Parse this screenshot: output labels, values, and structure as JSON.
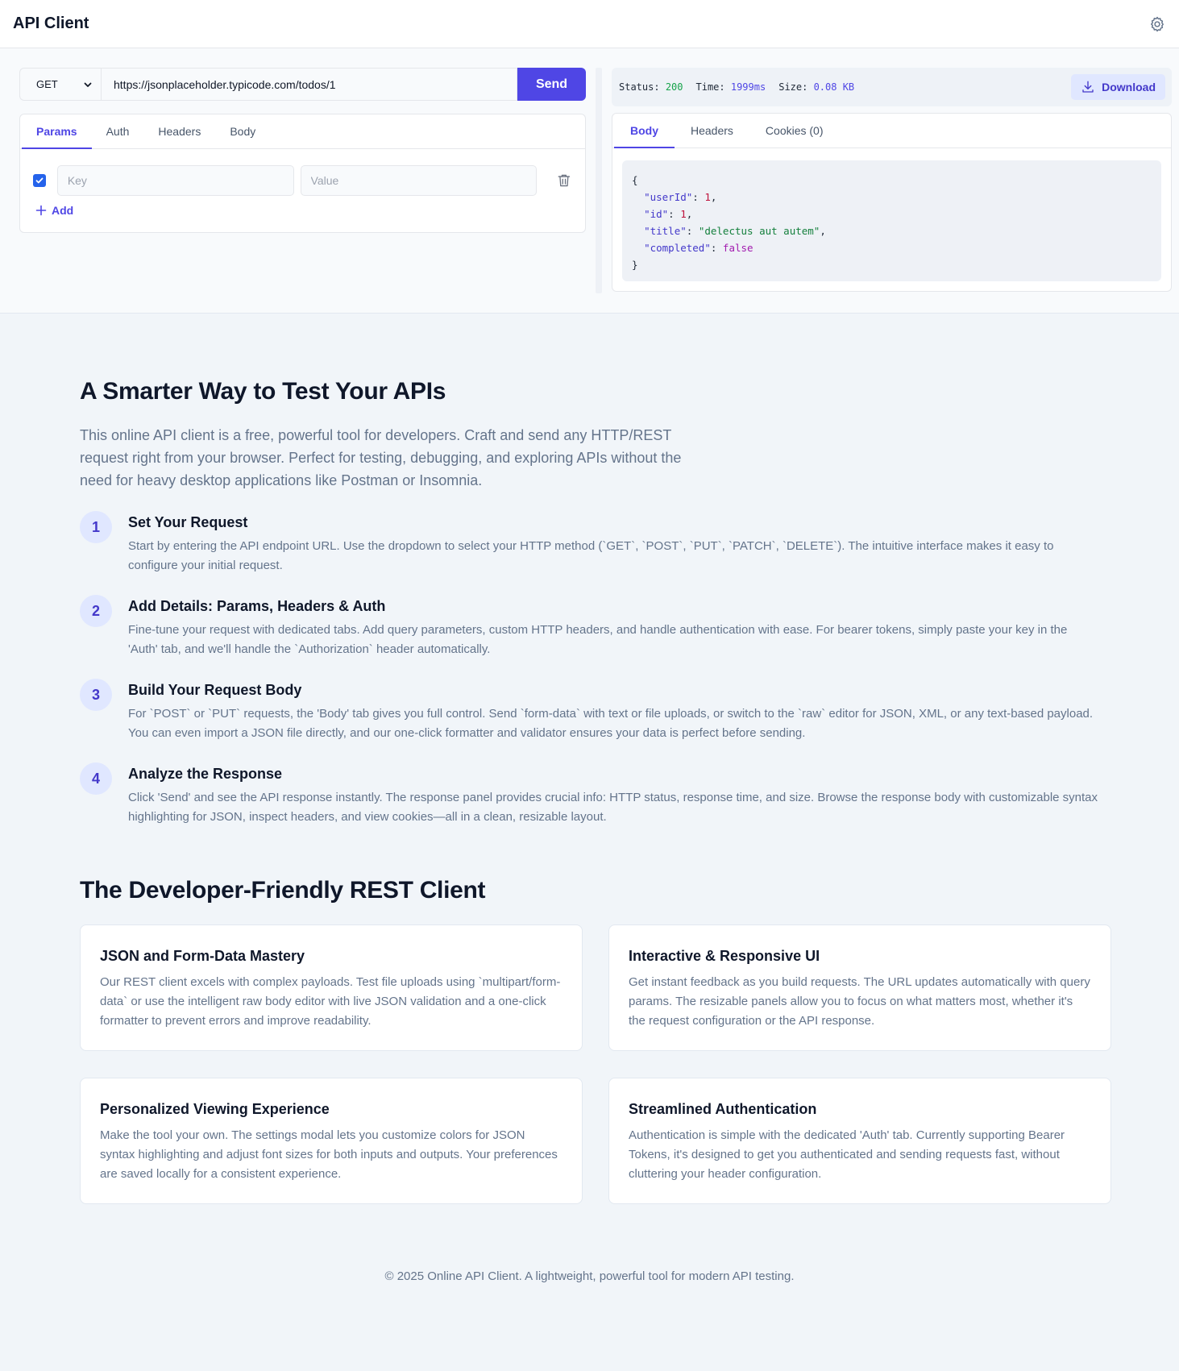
{
  "header": {
    "title": "API Client",
    "settings_icon": "gear-icon"
  },
  "request": {
    "method": "GET",
    "method_options": [
      "GET",
      "POST",
      "PUT",
      "PATCH",
      "DELETE"
    ],
    "url": "https://jsonplaceholder.typicode.com/todos/1",
    "send_label": "Send",
    "tabs": [
      "Params",
      "Auth",
      "Headers",
      "Body"
    ],
    "active_tab": "Params",
    "param": {
      "enabled": true,
      "key_placeholder": "Key",
      "value_placeholder": "Value"
    },
    "add_label": "Add"
  },
  "response": {
    "status_label": "Status:",
    "status_value": "200",
    "time_label": "Time:",
    "time_value": "1999ms",
    "size_label": "Size:",
    "size_value": "0.08 KB",
    "download_label": "Download",
    "tabs": [
      "Body",
      "Headers",
      "Cookies (0)"
    ],
    "active_tab": "Body",
    "body": [
      {
        "key": "userId",
        "value": "1",
        "type": "number"
      },
      {
        "key": "id",
        "value": "1",
        "type": "number"
      },
      {
        "key": "title",
        "value": "delectus aut autem",
        "type": "string"
      },
      {
        "key": "completed",
        "value": "false",
        "type": "boolean"
      }
    ]
  },
  "intro": {
    "heading": "A Smarter Way to Test Your APIs",
    "text": "This online API client is a free, powerful tool for developers. Craft and send any HTTP/REST request right from your browser. Perfect for testing, debugging, and exploring APIs without the need for heavy desktop applications like Postman or Insomnia."
  },
  "steps": [
    {
      "num": "1",
      "title": "Set Your Request",
      "desc": "Start by entering the API endpoint URL. Use the dropdown to select your HTTP method (`GET`, `POST`, `PUT`, `PATCH`, `DELETE`). The intuitive interface makes it easy to configure your initial request."
    },
    {
      "num": "2",
      "title": "Add Details: Params, Headers & Auth",
      "desc": "Fine-tune your request with dedicated tabs. Add query parameters, custom HTTP headers, and handle authentication with ease. For bearer tokens, simply paste your key in the 'Auth' tab, and we'll handle the `Authorization` header automatically."
    },
    {
      "num": "3",
      "title": "Build Your Request Body",
      "desc": "For `POST` or `PUT` requests, the 'Body' tab gives you full control. Send `form-data` with text or file uploads, or switch to the `raw` editor for JSON, XML, or any text-based payload. You can even import a JSON file directly, and our one-click formatter and validator ensures your data is perfect before sending."
    },
    {
      "num": "4",
      "title": "Analyze the Response",
      "desc": "Click 'Send' and see the API response instantly. The response panel provides crucial info: HTTP status, response time, and size. Browse the response body with customizable syntax highlighting for JSON, inspect headers, and view cookies—all in a clean, resizable layout."
    }
  ],
  "features": {
    "heading": "The Developer-Friendly REST Client",
    "cards": [
      {
        "title": "JSON and Form-Data Mastery",
        "desc": "Our REST client excels with complex payloads. Test file uploads using `multipart/form-data` or use the intelligent raw body editor with live JSON validation and a one-click formatter to prevent errors and improve readability."
      },
      {
        "title": "Interactive & Responsive UI",
        "desc": "Get instant feedback as you build requests. The URL updates automatically with query params. The resizable panels allow you to focus on what matters most, whether it's the request configuration or the API response."
      },
      {
        "title": "Personalized Viewing Experience",
        "desc": "Make the tool your own. The settings modal lets you customize colors for JSON syntax highlighting and adjust font sizes for both inputs and outputs. Your preferences are saved locally for a consistent experience."
      },
      {
        "title": "Streamlined Authentication",
        "desc": "Authentication is simple with the dedicated 'Auth' tab. Currently supporting Bearer Tokens, it's designed to get you authenticated and sending requests fast, without cluttering your header configuration."
      }
    ]
  },
  "footer": {
    "text": "© 2025 Online API Client. A lightweight, powerful tool for modern API testing."
  },
  "colors": {
    "accent": "#4f46e5",
    "status_ok": "#16a34a",
    "json_key": "#4338ca",
    "json_number": "#be123c",
    "json_string": "#15803d",
    "json_boolean": "#a21caf"
  }
}
